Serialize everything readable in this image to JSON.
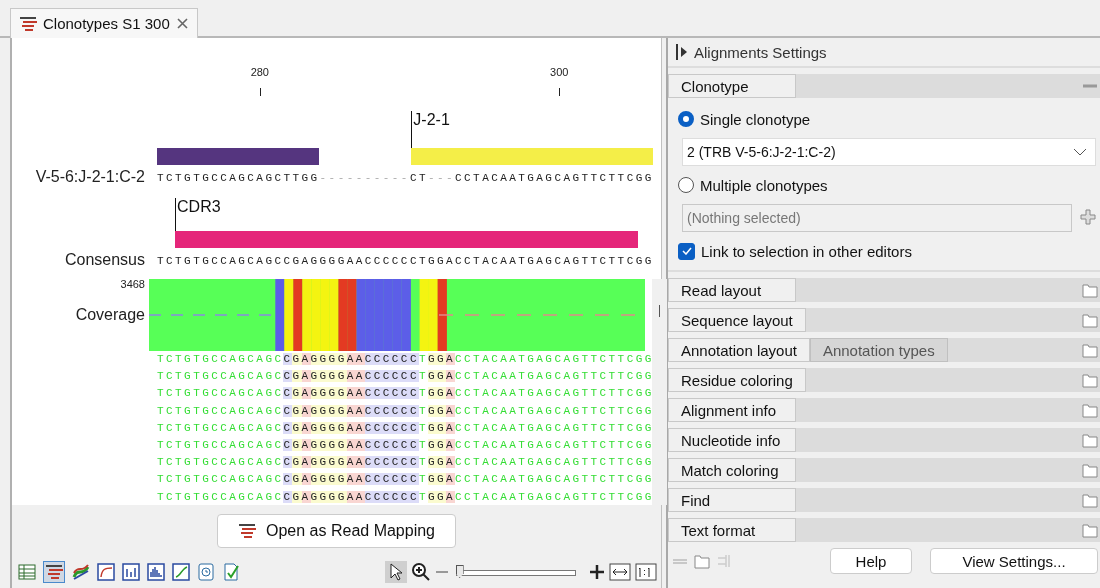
{
  "tab": {
    "title": "Clonotypes S1 300",
    "selected": true
  },
  "ruler": [
    "280",
    "300"
  ],
  "tracks": [
    {
      "kind": "annotation",
      "bars": [
        {
          "color": "#55357f"
        },
        {
          "label": "J-2-1",
          "color": "#f4ee48"
        }
      ]
    },
    {
      "kind": "sequence",
      "name": "V-5-6:J-2-1:C-2",
      "sequence": "TCTGTGCCAGCAGCTTGG----------CT---CCTACAATGAGCAGTTCTTCGG"
    },
    {
      "kind": "annotation",
      "bars": [
        {
          "label": "CDR3",
          "color": "#e5267a"
        }
      ]
    },
    {
      "kind": "sequence",
      "name": "Consensus",
      "sequence": "TCTGTGCCAGCAGCCGAGGGGAACCCCCCTGGACCTACAATGAGCAGTTCTTCGG"
    },
    {
      "kind": "coverage",
      "name": "Coverage",
      "max": "3468"
    }
  ],
  "reads": [
    "TCTGTGCCAGCAGCCGAGGGGAACCCCCCTGGACCTACAATGAGCAGTTCTTCGG",
    "TCTGTGCCAGCAGCCGAGGGGAACCCCCCTGGACCTACAATGAGCAGTTCTTCGG",
    "TCTGTGCCAGCAGCCGAGGGGAACCCCCCTGGACCTACAATGAGCAGTTCTTCGG",
    "TCTGTGCCAGCAGCCGAGGGGAACCCCCCTGGACCTACAATGAGCAGTTCTTCGG",
    "TCTGTGCCAGCAGCCGAGGGGAACCCCCCTGGACCTACAATGAGCAGTTCTTCGG",
    "TCTGTGCCAGCAGCCGAGGGGAACCCCCCTGGACCTACAATGAGCAGTTCTTCGG",
    "TCTGTGCCAGCAGCCGAGGGGAACCCCCCTGGACCTACAATGAGCAGTTCTTCGG",
    "TCTGTGCCAGCAGCCGAGGGGAACCCCCCTGGACCTACAATGAGCAGTTCTTCGG",
    "TCTGTGCCAGCAGCCGAGGGGAACCCCCCTGGACCTACAATGAGCAGTTCTTCGG"
  ],
  "open_button": "Open as Read Mapping",
  "view_buttons": [
    {
      "kind": "table",
      "selected": false
    },
    {
      "kind": "mapping",
      "selected": true
    },
    {
      "kind": "align",
      "selected": false
    },
    {
      "kind": "curve",
      "selected": false
    },
    {
      "kind": "bars",
      "selected": false
    },
    {
      "kind": "histogram",
      "selected": false
    },
    {
      "kind": "line",
      "selected": false
    },
    {
      "kind": "history",
      "selected": false
    },
    {
      "kind": "check",
      "selected": false
    }
  ],
  "zoom": {
    "level": 0.03
  },
  "settings": {
    "title": "Alignments Settings",
    "clonotype": {
      "title": "Clonotype",
      "options": [
        {
          "label": "Single clonotype",
          "selected": true
        },
        {
          "label": "Multiple clonotypes",
          "selected": false
        }
      ],
      "dropdown": "2 (TRB V-5-6:J-2-1:C-2)",
      "placeholder": "(Nothing selected)",
      "link": {
        "label": "Link to selection in other editors",
        "checked": true
      }
    },
    "sections": [
      {
        "title": "Read layout"
      },
      {
        "title": "Sequence layout"
      },
      {
        "title": "Annotation layout",
        "subtab": "Annotation types"
      },
      {
        "title": "Residue coloring"
      },
      {
        "title": "Alignment info"
      },
      {
        "title": "Nucleotide info"
      },
      {
        "title": "Match coloring"
      },
      {
        "title": "Find"
      },
      {
        "title": "Text format"
      }
    ]
  },
  "buttons": [
    "Help",
    "View Settings..."
  ]
}
